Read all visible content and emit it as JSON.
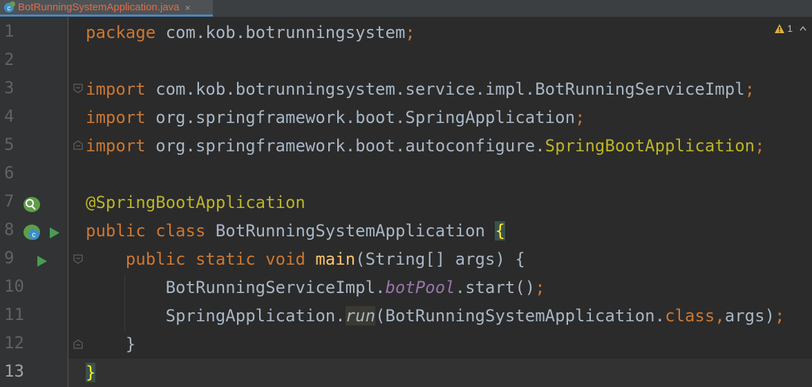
{
  "tab": {
    "title": "BotRunningSystemApplication.java",
    "close": "×"
  },
  "warnings": {
    "count": "1",
    "icon": "warning-icon"
  },
  "gutter": {
    "line_numbers": [
      "1",
      "2",
      "3",
      "4",
      "5",
      "6",
      "7",
      "8",
      "9",
      "10",
      "11",
      "12",
      "13"
    ],
    "current_line": 13
  },
  "code": {
    "l1_kw": "package",
    "l1_rest": " com.kob.botrunningsystem",
    "l1_semi": ";",
    "l3_kw": "import",
    "l3_rest": " com.kob.botrunningsystem.service.impl.BotRunningServiceImpl",
    "l3_semi": ";",
    "l4_kw": "import",
    "l4_rest": " org.springframework.boot.SpringApplication",
    "l4_semi": ";",
    "l5_kw": "import",
    "l5_rest": " org.springframework.boot.autoconfigure.",
    "l5_ann": "SpringBootApplication",
    "l5_semi": ";",
    "l7_ann": "@SpringBootApplication",
    "l8_kw1": "public",
    "l8_kw2": "class",
    "l8_name": " BotRunningSystemApplication ",
    "l8_brace": "{",
    "l9_indent": "    ",
    "l9_kw1": "public",
    "l9_kw2": "static",
    "l9_kw3": "void",
    "l9_fn": "main",
    "l9_rest": "(String[] args) {",
    "l10_indent": "        ",
    "l10_cls": "BotRunningServiceImpl.",
    "l10_field": "botPool",
    "l10_rest": ".start()",
    "l10_semi": ";",
    "l11_indent": "        ",
    "l11_cls": "SpringApplication.",
    "l11_stat": "run",
    "l11_rest1": "(BotRunningSystemApplication.",
    "l11_kw": "class",
    "l11_comma": ",",
    "l11_rest2": "args)",
    "l11_semi": ";",
    "l12_indent": "    ",
    "l12_brace": "}",
    "l13_brace": "}"
  },
  "colors": {
    "background": "#2b2b2b",
    "keyword": "#cc7832",
    "annotation": "#bbb529",
    "method": "#ffc66d",
    "field": "#9876aa",
    "text": "#a9b7c6",
    "run_green": "#499c54"
  }
}
